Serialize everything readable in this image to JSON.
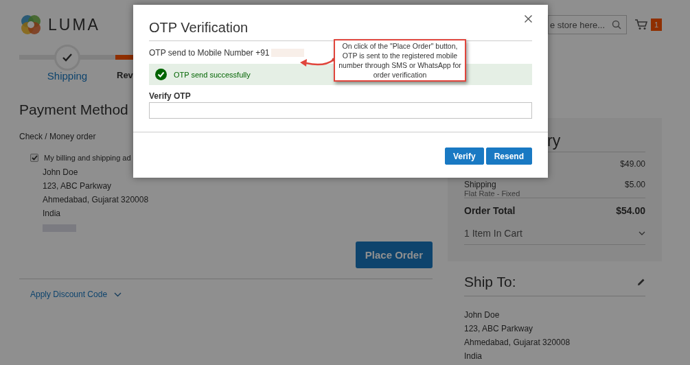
{
  "header": {
    "logo_text": "LUMA",
    "search_placeholder": "e store here...",
    "cart_count": "1"
  },
  "progress": {
    "steps": [
      {
        "label": "Shipping",
        "selected": false
      },
      {
        "label": "Rev",
        "selected": true
      }
    ]
  },
  "payment": {
    "title": "Payment Method",
    "method": "Check / Money order",
    "same_address": {
      "label": "My billing and shipping ad",
      "checked": true
    },
    "address": [
      "John Doe",
      "123, ABC Parkway",
      "Ahmedabad, Gujarat 320008",
      "India"
    ],
    "place_order": "Place Order",
    "discount": "Apply Discount Code"
  },
  "summary": {
    "title": "ry",
    "rows": [
      {
        "amount": "$49.00"
      },
      {
        "label": "Shipping",
        "sublabel": "Flat Rate - Fixed",
        "amount": "$5.00"
      }
    ],
    "total": {
      "label": "Order Total",
      "amount": "$54.00"
    },
    "cart": "1 Item In Cart"
  },
  "ship_to": {
    "title": "Ship To:",
    "address": [
      "John Doe",
      "123, ABC Parkway",
      "Ahmedabad, Gujarat 320008",
      "India"
    ]
  },
  "modal": {
    "title": "OTP Verification",
    "mobile_label": "OTP send to Mobile Number +91",
    "message": "OTP send successfully",
    "otp_label": "Verify OTP",
    "buttons": [
      "Verify",
      "Resend"
    ]
  },
  "annotation": {
    "text": "On click of the \"Place Order\" button, OTP is sent to the registered mobile number through SMS or WhatsApp for order verification"
  }
}
